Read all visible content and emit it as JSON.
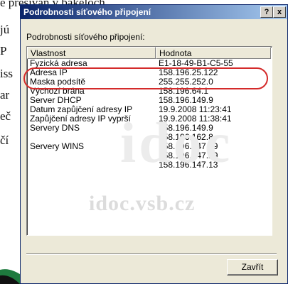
{
  "background": {
    "lines": [
      "e přesíván v bakeloch",
      "jú",
      "P",
      "iss",
      "ar",
      "eč",
      "čí"
    ]
  },
  "dialog": {
    "title": "Podrobnosti síťového připojení",
    "help_label": "?",
    "close_x": "x",
    "group_label": "Podrobnosti síťového připojení:",
    "columns": [
      "Vlastnost",
      "Hodnota"
    ],
    "rows": [
      {
        "property": "Fyzická adresa",
        "value": "E1-18-49-B1-C5-55"
      },
      {
        "property": "Adresa IP",
        "value": "158.196.25.122"
      },
      {
        "property": "Maska podsítě",
        "value": "255.255.252.0"
      },
      {
        "property": "Výchozí brána",
        "value": "158.196.64.1"
      },
      {
        "property": "Server DHCP",
        "value": "158.196.149.9"
      },
      {
        "property": "Datum zapůjčení adresy IP",
        "value": "19.9.2008 11:23:41"
      },
      {
        "property": "Zapůjčení adresy IP vyprší",
        "value": "19.9.2008 11:38:41"
      },
      {
        "property": "Servery DNS",
        "value": "158.196.149.9"
      },
      {
        "property": "",
        "value": "158.196.162.8"
      },
      {
        "property": "Servery WINS",
        "value": "158.196.147.49"
      },
      {
        "property": "",
        "value": "158.196.147.29"
      },
      {
        "property": "",
        "value": "158.196.147.13"
      }
    ],
    "close_button_label": "Zavřít",
    "highlight_color": "#d42a2a"
  },
  "watermark": {
    "big": "idoc",
    "url": "idoc.vsb.cz"
  }
}
